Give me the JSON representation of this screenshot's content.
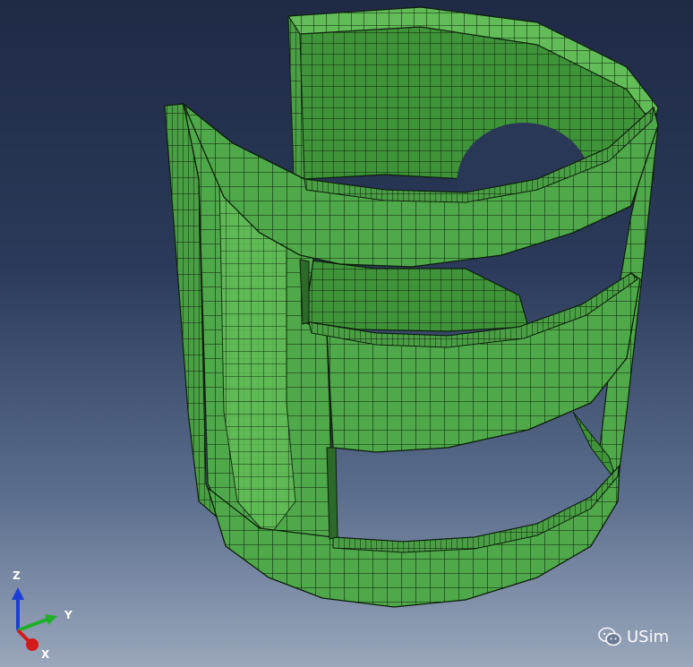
{
  "viewport": {
    "background_top": "#1f2a45",
    "background_bottom": "#9aa7bc"
  },
  "model": {
    "mesh_color": "#4fa84a",
    "mesh_color_light": "#68c25f",
    "mesh_color_dark": "#3a8a36",
    "edge_color": "#0d1f0b"
  },
  "triad": {
    "z_label": "Z",
    "y_label": "Y",
    "x_label": "X",
    "z_color": "#1b3fd6",
    "y_color": "#1fb02a",
    "x_color": "#d41a1a"
  },
  "watermark": {
    "text": "USim",
    "icon": "wechat-icon"
  }
}
